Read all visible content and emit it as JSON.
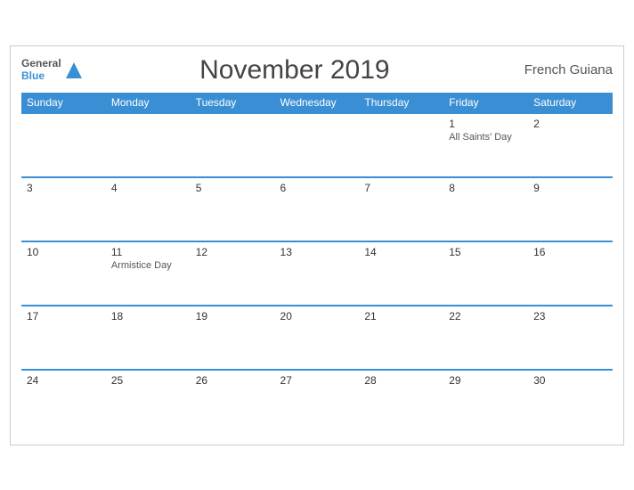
{
  "header": {
    "logo_general": "General",
    "logo_blue": "Blue",
    "title": "November 2019",
    "region": "French Guiana"
  },
  "weekdays": [
    "Sunday",
    "Monday",
    "Tuesday",
    "Wednesday",
    "Thursday",
    "Friday",
    "Saturday"
  ],
  "weeks": [
    [
      {
        "day": "",
        "holiday": ""
      },
      {
        "day": "",
        "holiday": ""
      },
      {
        "day": "",
        "holiday": ""
      },
      {
        "day": "",
        "holiday": ""
      },
      {
        "day": "",
        "holiday": ""
      },
      {
        "day": "1",
        "holiday": "All Saints' Day"
      },
      {
        "day": "2",
        "holiday": ""
      }
    ],
    [
      {
        "day": "3",
        "holiday": ""
      },
      {
        "day": "4",
        "holiday": ""
      },
      {
        "day": "5",
        "holiday": ""
      },
      {
        "day": "6",
        "holiday": ""
      },
      {
        "day": "7",
        "holiday": ""
      },
      {
        "day": "8",
        "holiday": ""
      },
      {
        "day": "9",
        "holiday": ""
      }
    ],
    [
      {
        "day": "10",
        "holiday": ""
      },
      {
        "day": "11",
        "holiday": "Armistice Day"
      },
      {
        "day": "12",
        "holiday": ""
      },
      {
        "day": "13",
        "holiday": ""
      },
      {
        "day": "14",
        "holiday": ""
      },
      {
        "day": "15",
        "holiday": ""
      },
      {
        "day": "16",
        "holiday": ""
      }
    ],
    [
      {
        "day": "17",
        "holiday": ""
      },
      {
        "day": "18",
        "holiday": ""
      },
      {
        "day": "19",
        "holiday": ""
      },
      {
        "day": "20",
        "holiday": ""
      },
      {
        "day": "21",
        "holiday": ""
      },
      {
        "day": "22",
        "holiday": ""
      },
      {
        "day": "23",
        "holiday": ""
      }
    ],
    [
      {
        "day": "24",
        "holiday": ""
      },
      {
        "day": "25",
        "holiday": ""
      },
      {
        "day": "26",
        "holiday": ""
      },
      {
        "day": "27",
        "holiday": ""
      },
      {
        "day": "28",
        "holiday": ""
      },
      {
        "day": "29",
        "holiday": ""
      },
      {
        "day": "30",
        "holiday": ""
      }
    ]
  ]
}
